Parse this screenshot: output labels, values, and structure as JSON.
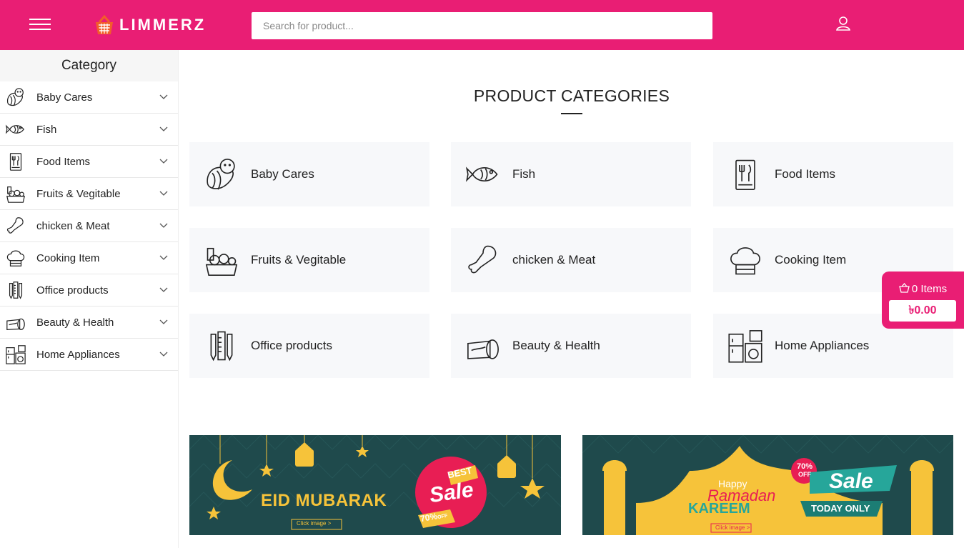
{
  "header": {
    "brand": "LIMMERZ",
    "search_placeholder": "Search for product..."
  },
  "sidebar": {
    "title": "Category",
    "items": [
      {
        "label": "Baby Cares",
        "icon": "baby-icon"
      },
      {
        "label": "Fish",
        "icon": "fish-icon"
      },
      {
        "label": "Food Items",
        "icon": "food-menu-icon"
      },
      {
        "label": "Fruits & Vegitable",
        "icon": "fruits-basket-icon"
      },
      {
        "label": "chicken & Meat",
        "icon": "chicken-leg-icon"
      },
      {
        "label": "Cooking Item",
        "icon": "chef-hat-icon"
      },
      {
        "label": "Office products",
        "icon": "pens-ruler-icon"
      },
      {
        "label": "Beauty & Health",
        "icon": "cream-jar-icon"
      },
      {
        "label": "Home Appliances",
        "icon": "appliances-icon"
      }
    ]
  },
  "main": {
    "title": "PRODUCT CATEGORIES",
    "categories": [
      {
        "label": "Baby Cares"
      },
      {
        "label": "Fish"
      },
      {
        "label": "Food Items"
      },
      {
        "label": "Fruits & Vegitable"
      },
      {
        "label": "chicken & Meat"
      },
      {
        "label": "Cooking Item"
      },
      {
        "label": "Office products"
      },
      {
        "label": "Beauty & Health"
      },
      {
        "label": "Home Appliances"
      }
    ]
  },
  "cart": {
    "items_label": "0 Items",
    "price": "৳0.00"
  },
  "banners": {
    "eid": {
      "title": "EID MUBARAK",
      "badge_top": "BEST",
      "badge_main": "Sale",
      "badge_off": "70%",
      "badge_off_suffix": "OFF",
      "click": "Click image >"
    },
    "ramadan": {
      "happy": "Happy",
      "ramadan": "Ramadan",
      "kareem": "KAREEM",
      "off": "70%",
      "off_suffix": "OFF",
      "sale": "Sale",
      "today": "TODAY ONLY",
      "click": "Click image >"
    }
  },
  "colors": {
    "brand": "#e91e74",
    "banner_bg": "#1f4a4c",
    "gold": "#f6c33a"
  }
}
